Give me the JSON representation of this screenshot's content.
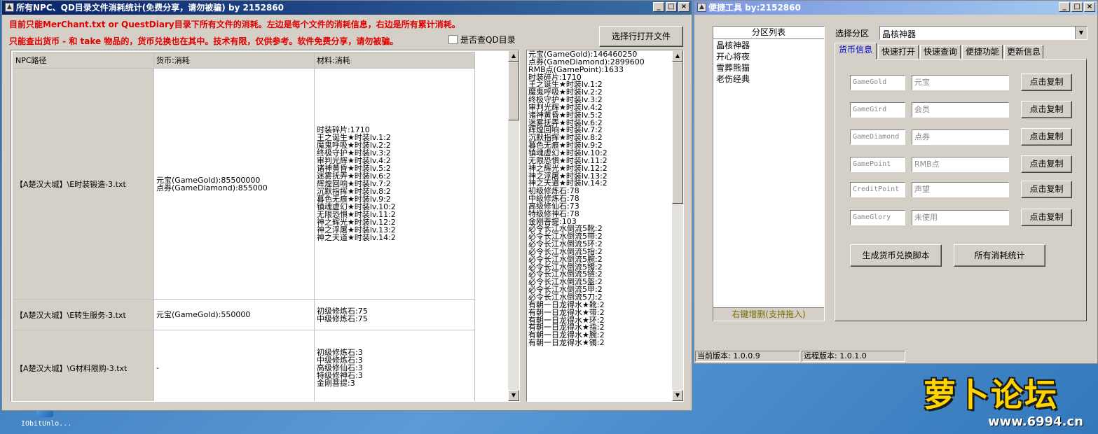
{
  "desktop": {
    "icon_label": "IObitUnlo...",
    "logo_text": "萝卜论坛",
    "logo_url": "www.6994.cn"
  },
  "main_window": {
    "title": "所有NPC、QD目录文件消耗统计(免费分享，请勿被骗)      by 2152860",
    "note_line1": "目前只能MerChant.txt or QuestDiary目录下所有文件的消耗。左边是每个文件的消耗信息，右边是所有累计消耗。",
    "note_line2": "只能查出货币 - 和 take 物品的，货币兑换也在其中。技术有限，仅供参考。软件免费分享，请勿被骗。",
    "checkbox_label": "是否查QD目录",
    "open_button": "选择行打开文件",
    "table": {
      "headers": [
        "NPC路径",
        "货币:消耗",
        "材料:消耗"
      ],
      "rows": [
        {
          "path": "【A楚汉大城】\\E时装锻造-3.txt",
          "currency": "元宝(GameGold):85500000\n点券(GameDiamond):855000",
          "materials": "时装碎片:1710\n王之诞生★时装lv.1:2\n魔鬼呼吸★时装lv.2:2\n终极守护★时装lv.3:2\n审判光辉★时装lv.4:2\n诸神黄昏★时装lv.5:2\n迷雾抚弄★时装lv.6:2\n辉煌回响★时装lv.7:2\n沉默指挥★时装lv.8:2\n暮色无痕★时装lv.9:2\n镇魂虚幻★时装lv.10:2\n无限恐惧★时装lv.11:2\n神之辉光★时装lv.12:2\n神之浮屠★时装lv.13:2\n神之天道★时装lv.14:2"
        },
        {
          "path": "【A楚汉大城】\\E转生服务-3.txt",
          "currency": "元宝(GameGold):550000",
          "materials": "初级修炼石:75\n中级修炼石:75"
        },
        {
          "path": "【A楚汉大城】\\G材料限购-3.txt",
          "currency": "-",
          "materials": "初级修炼石:3\n中级修炼石:3\n高级修仙石:3\n特级修神石:3\n金刚菩提:3"
        }
      ]
    },
    "summary_lines": [
      "元宝(GameGold):146460250",
      "点券(GameDiamond):2899600",
      "RMB点(GamePoint):1633",
      "时装碎片:1710",
      "王之诞生★时装lv.1:2",
      "魔鬼呼吸★时装lv.2:2",
      "终极守护★时装lv.3:2",
      "审判光辉★时装lv.4:2",
      "诸神黄昏★时装lv.5:2",
      "迷雾抚弄★时装lv.6:2",
      "辉煌回响★时装lv.7:2",
      "沉默指挥★时装lv.8:2",
      "暮色无痕★时装lv.9:2",
      "镇魂虚幻★时装lv.10:2",
      "无限恐惧★时装lv.11:2",
      "神之辉光★时装lv.12:2",
      "神之浮屠★时装lv.13:2",
      "神之天道★时装lv.14:2",
      "初级修炼石:78",
      "中级修炼石:78",
      "高级修仙石:73",
      "特级修神石:78",
      "金刚菩提:103",
      "必令长江水倒流5靴:2",
      "必令长江水倒流5带:2",
      "必令长江水倒流5环:2",
      "必令长江水倒流5指:2",
      "必令长江水倒流5腕:2",
      "必令长江水倒流5镯:2",
      "必令长江水倒流5链:2",
      "必令长江水倒流5盔:2",
      "必令长江水倒流5甲:2",
      "必令长江水倒流5刀:2",
      "有朝一日龙得水★靴:2",
      "有朝一日龙得水★带:2",
      "有朝一日龙得水★环:2",
      "有朝一日龙得水★指:2",
      "有朝一日龙得水★腕:2",
      "有朝一日龙得水★镯:2"
    ]
  },
  "tool_window": {
    "title": "便捷工具   by:2152860",
    "zone_list_header": "分区列表",
    "zones": [
      "晶核神器",
      "开心将夜",
      "雪葬熊猫",
      "老伤经典"
    ],
    "zone_list_footer": "右键增删(支持拖入)",
    "select_label": "选择分区",
    "selected_zone": "晶核神器",
    "tabs": [
      "货币信息",
      "快速打开",
      "快速查询",
      "便捷功能",
      "更新信息"
    ],
    "currency_rows": [
      {
        "code": "GameGold",
        "name": "元宝",
        "copy": "点击复制"
      },
      {
        "code": "GameGird",
        "name": "会员",
        "copy": "点击复制"
      },
      {
        "code": "GameDiamond",
        "name": "点券",
        "copy": "点击复制"
      },
      {
        "code": "GamePoint",
        "name": "RMB点",
        "copy": "点击复制"
      },
      {
        "code": "CreditPoint",
        "name": "声望",
        "copy": "点击复制"
      },
      {
        "code": "GameGlory",
        "name": "未使用",
        "copy": "点击复制"
      }
    ],
    "gen_script_button": "生成货币兑换脚本",
    "all_stats_button": "所有消耗统计",
    "current_version": "当前版本: 1.0.0.9",
    "remote_version": "远程版本: 1.0.1.0"
  }
}
